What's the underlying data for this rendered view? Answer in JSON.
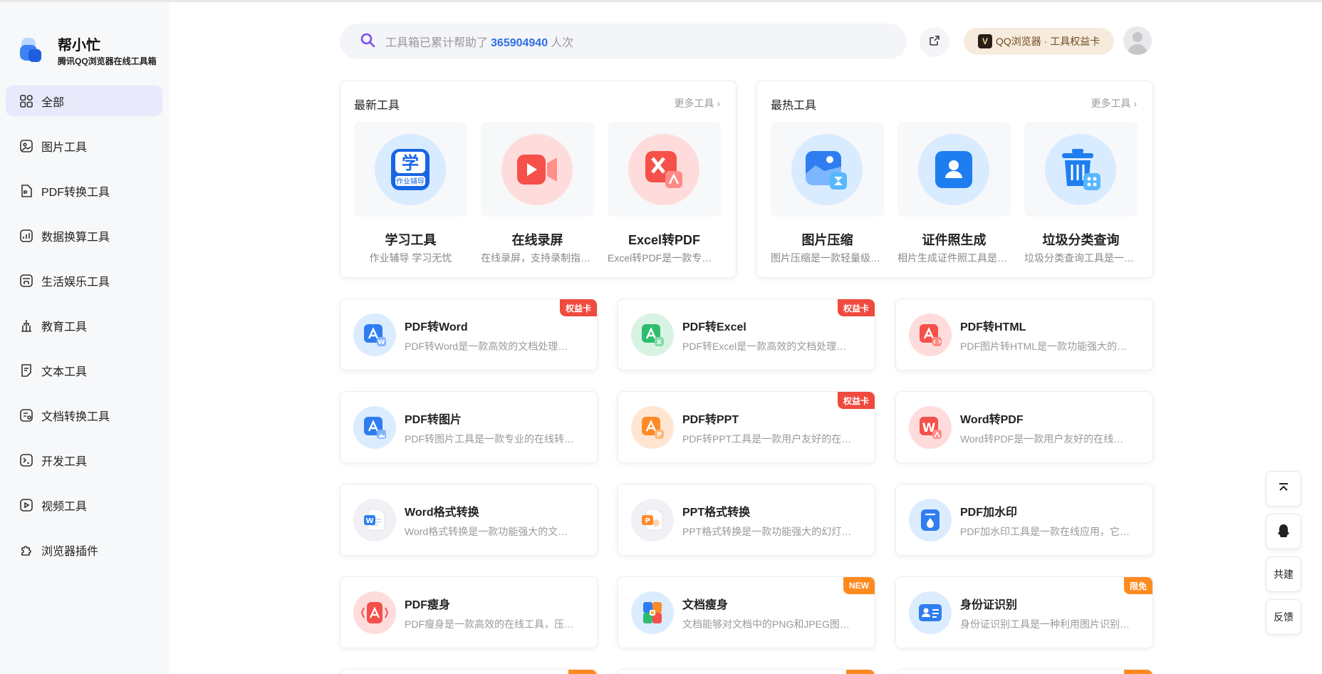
{
  "brand": {
    "name": "帮小忙",
    "subtitle": "腾讯QQ浏览器在线工具箱"
  },
  "sidebar": {
    "items": [
      {
        "label": "全部",
        "icon": "grid-icon",
        "active": true
      },
      {
        "label": "图片工具",
        "icon": "image-icon"
      },
      {
        "label": "PDF转换工具",
        "icon": "pdf-file-icon"
      },
      {
        "label": "数据换算工具",
        "icon": "chart-icon"
      },
      {
        "label": "生活娱乐工具",
        "icon": "store-icon"
      },
      {
        "label": "教育工具",
        "icon": "bank-icon"
      },
      {
        "label": "文本工具",
        "icon": "document-icon"
      },
      {
        "label": "文档转换工具",
        "icon": "doc-convert-icon"
      },
      {
        "label": "开发工具",
        "icon": "terminal-icon"
      },
      {
        "label": "视频工具",
        "icon": "video-icon"
      },
      {
        "label": "浏览器插件",
        "icon": "puzzle-icon"
      }
    ]
  },
  "search": {
    "prefix": "工具箱已累计帮助了",
    "count": "365904940",
    "suffix": "人次"
  },
  "header": {
    "vip_badge": "V",
    "vip_text": "QQ浏览器 · 工具权益卡"
  },
  "latest": {
    "title": "最新工具",
    "more": "更多工具",
    "tools": [
      {
        "name": "学习工具",
        "desc": "作业辅导 学习无忧",
        "icon": "study-icon"
      },
      {
        "name": "在线录屏",
        "desc": "在线录屏，支持录制指定窗口",
        "icon": "screen-record-icon"
      },
      {
        "name": "Excel转PDF",
        "desc": "Excel转PDF是一款专业的转换工具",
        "icon": "excel-to-pdf-icon"
      }
    ]
  },
  "hottest": {
    "title": "最热工具",
    "more": "更多工具",
    "tools": [
      {
        "name": "图片压缩",
        "desc": "图片压缩是一款轻量级的在线工具",
        "icon": "image-compress-icon"
      },
      {
        "name": "证件照生成",
        "desc": "相片生成证件照工具是一款在线工具",
        "icon": "id-photo-icon"
      },
      {
        "name": "垃圾分类查询",
        "desc": "垃圾分类查询工具是一款便民工具",
        "icon": "trash-icon"
      }
    ]
  },
  "tools": [
    {
      "title": "PDF转Word",
      "desc": "PDF转Word是一款高效的文档处理工具",
      "badge": "权益卡",
      "badge_color": "red",
      "icon": "pdf-to-word-icon"
    },
    {
      "title": "PDF转Excel",
      "desc": "PDF转Excel是一款高效的文档处理工具",
      "badge": "权益卡",
      "badge_color": "red",
      "icon": "pdf-to-excel-icon"
    },
    {
      "title": "PDF转HTML",
      "desc": "PDF图片转HTML是一款功能强大的工具",
      "badge": "",
      "icon": "pdf-to-html-icon"
    },
    {
      "title": "PDF转图片",
      "desc": "PDF转图片工具是一款专业的在线转换工具",
      "badge": "",
      "icon": "pdf-to-image-icon"
    },
    {
      "title": "PDF转PPT",
      "desc": "PDF转PPT工具是一款用户友好的在线工具",
      "badge": "权益卡",
      "badge_color": "red",
      "icon": "pdf-to-ppt-icon"
    },
    {
      "title": "Word转PDF",
      "desc": "Word转PDF是一款用户友好的在线工具",
      "badge": "",
      "icon": "word-to-pdf-icon"
    },
    {
      "title": "Word格式转换",
      "desc": "Word格式转换是一款功能强大的文档工具",
      "badge": "",
      "icon": "word-format-icon"
    },
    {
      "title": "PPT格式转换",
      "desc": "PPT格式转换是一款功能强大的幻灯片工具",
      "badge": "",
      "icon": "ppt-format-icon"
    },
    {
      "title": "PDF加水印",
      "desc": "PDF加水印工具是一款在线应用，它可以",
      "badge": "",
      "icon": "pdf-watermark-icon"
    },
    {
      "title": "PDF瘦身",
      "desc": "PDF瘦身是一款高效的在线工具，压缩文件",
      "badge": "",
      "icon": "pdf-compress-icon"
    },
    {
      "title": "文档瘦身",
      "desc": "文档能够对文档中的PNG和JPEG图片压缩",
      "badge": "NEW",
      "badge_color": "orange",
      "icon": "doc-compress-icon"
    },
    {
      "title": "身份证识别",
      "desc": "身份证识别工具是一种利用图片识别技术",
      "badge": "限免",
      "badge_color": "orange",
      "icon": "id-card-icon"
    }
  ],
  "float": {
    "top": "back-to-top-icon",
    "qq": "qq-icon",
    "cobuild": "共建",
    "feedback": "反馈"
  }
}
